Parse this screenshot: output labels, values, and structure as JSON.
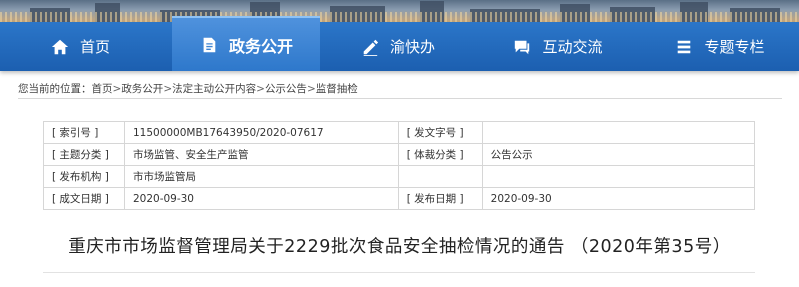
{
  "nav": {
    "items": [
      {
        "label": "首页",
        "icon": "home-icon"
      },
      {
        "label": "政务公开",
        "icon": "document-icon",
        "active": true
      },
      {
        "label": "渝快办",
        "icon": "pen-icon"
      },
      {
        "label": "互动交流",
        "icon": "chat-icon"
      },
      {
        "label": "专题专栏",
        "icon": "list-icon"
      }
    ]
  },
  "breadcrumb": {
    "prefix": "您当前的位置：",
    "items": [
      "首页",
      "政务公开",
      "法定主动公开内容",
      "公示公告",
      "监督抽检"
    ],
    "separator": ">"
  },
  "meta": {
    "rows": [
      {
        "l1": "[ 索引号 ]",
        "v1": "11500000MB17643950/2020-07617",
        "l2": "[ 发文字号 ]",
        "v2": ""
      },
      {
        "l1": "[ 主题分类 ]",
        "v1": "市场监管、安全生产监管",
        "l2": "[ 体裁分类 ]",
        "v2": "公告公示"
      },
      {
        "l1": "[ 发布机构 ]",
        "v1": "市市场监管局",
        "l2": "",
        "v2": ""
      },
      {
        "l1": "[ 成文日期 ]",
        "v1": "2020-09-30",
        "l2": "[ 发布日期 ]",
        "v2": "2020-09-30"
      }
    ]
  },
  "article": {
    "title": "重庆市市场监督管理局关于2229批次食品安全抽检情况的通告 （2020年第35号）"
  }
}
